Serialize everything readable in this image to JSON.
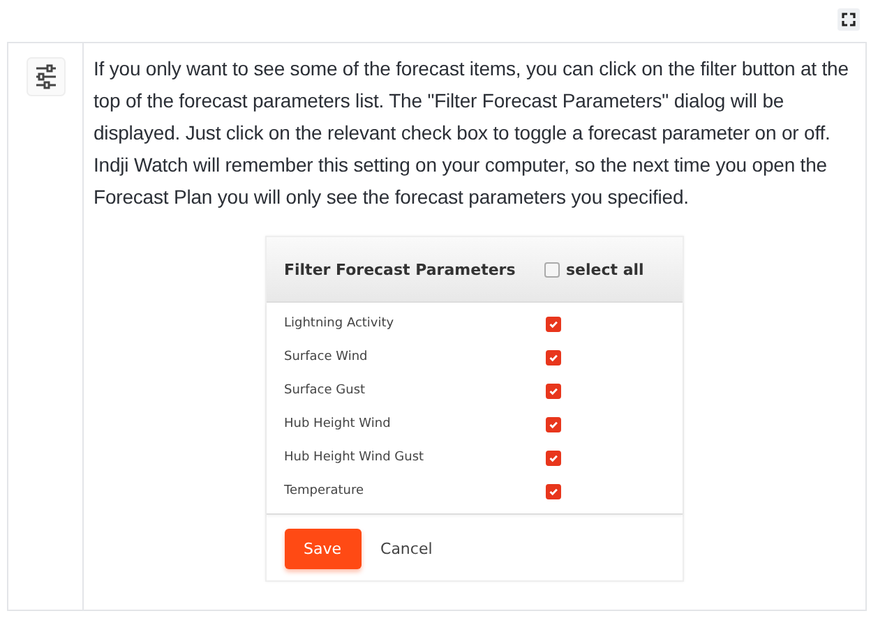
{
  "paragraph": "If you only want to see some of the forecast items, you can click on the filter button at the top of the forecast parameters list. The \"Filter Forecast Parameters\" dialog will be displayed. Just click on the relevant check box to toggle a forecast parameter on or off. Indji Watch will remember this setting on your computer, so the next time you open the Forecast Plan you will only see the forecast parameters you specified.",
  "dialog": {
    "title": "Filter Forecast Parameters",
    "select_all": {
      "label": "select all",
      "checked": false
    },
    "parameters": [
      {
        "label": "Lightning Activity",
        "checked": true
      },
      {
        "label": "Surface Wind",
        "checked": true
      },
      {
        "label": "Surface Gust",
        "checked": true
      },
      {
        "label": "Hub Height Wind",
        "checked": true
      },
      {
        "label": "Hub Height Wind Gust",
        "checked": true
      },
      {
        "label": "Temperature",
        "checked": true
      }
    ],
    "buttons": [
      "Save",
      "Cancel"
    ]
  }
}
